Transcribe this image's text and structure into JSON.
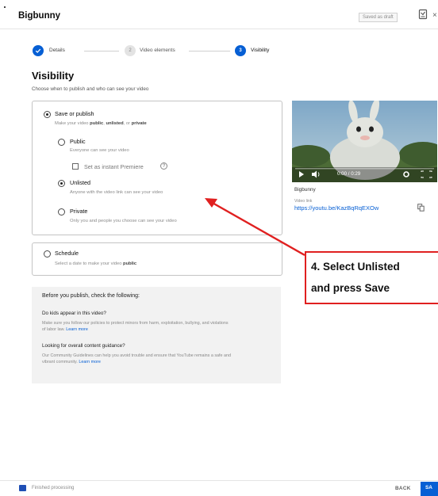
{
  "header": {
    "title": "Bigbunny",
    "draft_status": "Saved as draft",
    "close_glyph": "×"
  },
  "steps": [
    {
      "number": "✓",
      "label": "Details",
      "state": "done"
    },
    {
      "number": "2",
      "label": "Video elements",
      "state": "inactive"
    },
    {
      "number": "3",
      "label": "Visibility",
      "state": "active"
    }
  ],
  "visibility": {
    "title": "Visibility",
    "subtitle": "Choose when to publish and who can see your video",
    "save_or_publish": {
      "label": "Save or publish",
      "desc_parts": [
        "Make your video ",
        "public",
        ", ",
        "unlisted",
        ", or ",
        "private"
      ],
      "selected": true
    },
    "options": [
      {
        "label": "Public",
        "desc": "Everyone can see your video",
        "selected": false
      },
      {
        "label": "Unlisted",
        "desc": "Anyone with the video link can see your video",
        "selected": true
      },
      {
        "label": "Private",
        "desc": "Only you and people you choose can see your video",
        "selected": false
      }
    ],
    "premiere_label": "Set as instant Premiere",
    "help_glyph": "?",
    "schedule": {
      "label": "Schedule",
      "desc": "Select a date to make your video ",
      "desc_bold": "public"
    }
  },
  "checklist": {
    "title": "Before you publish, check the following:",
    "items": [
      {
        "heading": "Do kids appear in this video?",
        "text": "Make sure you follow our policies to protect minors from harm, exploitation, bullying, and violations of labor law.",
        "link": "Learn more"
      },
      {
        "heading": "Looking for overall content guidance?",
        "text": "Our Community Guidelines can help you avoid trouble and ensure that YouTube remains a safe and vibrant community.",
        "link": "Learn more"
      }
    ]
  },
  "video": {
    "time": "0:00 / 0:29",
    "title": "Bigbunny",
    "link_label": "Video link",
    "link": "https://youtu.be/KazBqRqEXOw"
  },
  "callout": {
    "line1": "4. Select Unlisted",
    "line2": "and press Save",
    "color": "#e02020"
  },
  "footer": {
    "status": "Finished processing",
    "back": "BACK",
    "save": "SA"
  },
  "colors": {
    "accent": "#065fd4",
    "arrow": "#e02020"
  }
}
